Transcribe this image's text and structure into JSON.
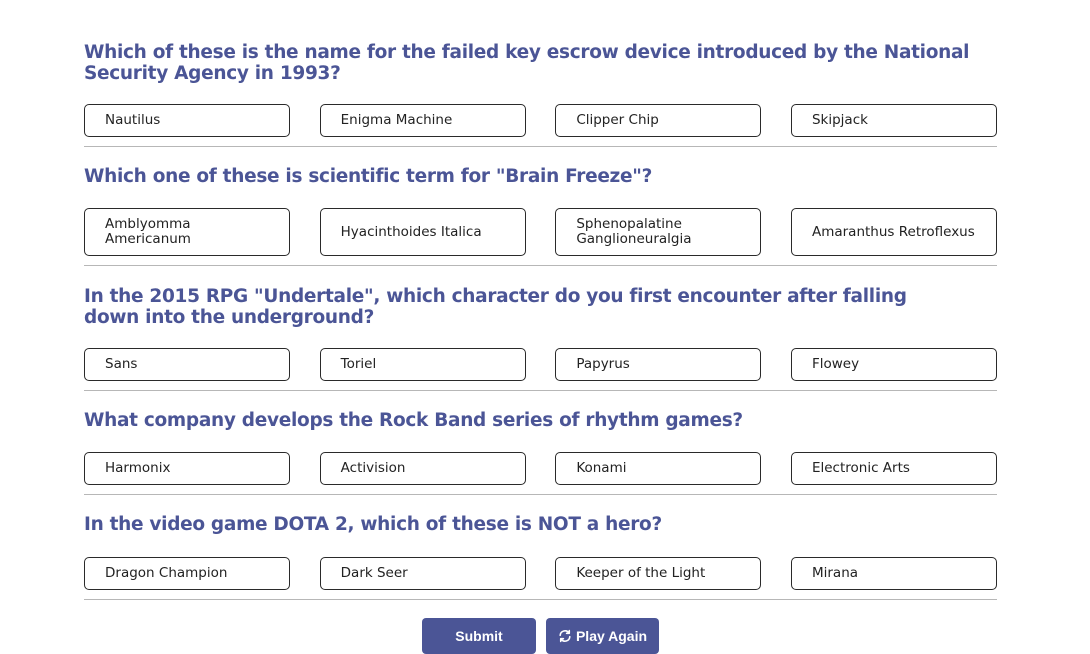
{
  "questions": [
    {
      "text": "Which of these is the name for the failed key escrow device introduced by the National Security Agency in 1993?",
      "answers": [
        "Nautilus",
        "Enigma Machine",
        "Clipper Chip",
        "Skipjack"
      ]
    },
    {
      "text": "Which one of these is scientific term for \"Brain Freeze\"?",
      "answers": [
        "Amblyomma Americanum",
        "Hyacinthoides Italica",
        "Sphenopalatine Ganglioneuralgia",
        "Amaranthus Retroflexus"
      ]
    },
    {
      "text": "In the 2015 RPG \"Undertale\", which character do you first encounter after falling down into the underground?",
      "answers": [
        "Sans",
        "Toriel",
        "Papyrus",
        "Flowey"
      ]
    },
    {
      "text": "What company develops the Rock Band series of rhythm games?",
      "answers": [
        "Harmonix",
        "Activision",
        "Konami",
        "Electronic Arts"
      ]
    },
    {
      "text": "In the video game DOTA 2, which of these is NOT a hero?",
      "answers": [
        "Dragon Champion",
        "Dark Seer",
        "Keeper of the Light",
        "Mirana"
      ]
    }
  ],
  "buttons": {
    "submit_label": "Submit",
    "play_again_label": "Play Again",
    "play_again_icon": "refresh-icon"
  },
  "colors": {
    "accent": "#4b5596",
    "divider": "#b7b7b7",
    "answer_border": "#2a2a2a"
  }
}
